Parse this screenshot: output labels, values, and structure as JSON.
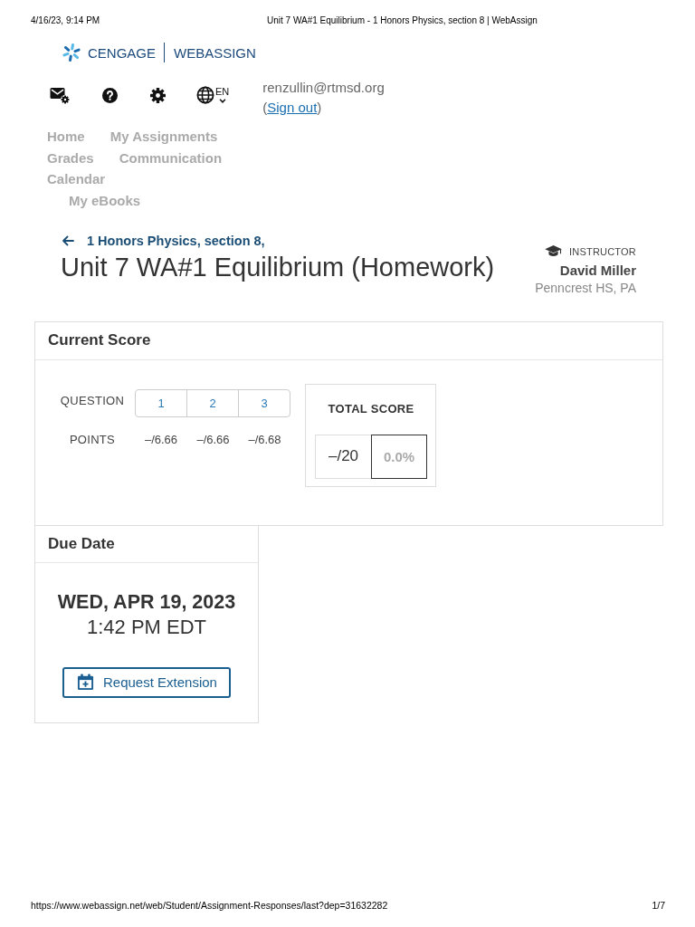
{
  "print_header": {
    "date": "4/16/23, 9:14 PM",
    "title": "Unit 7 WA#1 Equilibrium - 1 Honors Physics, section 8 | WebAssign"
  },
  "logo": {
    "brand": "CENGAGE",
    "product": "WEBASSIGN"
  },
  "toolbar": {
    "language": "EN"
  },
  "account": {
    "email": "renzullin@rtmsd.org",
    "sign_out": {
      "open": "(",
      "link": "Sign out",
      "close": ")"
    }
  },
  "nav_rows": [
    {
      "items": [
        {
          "label": "Home"
        },
        {
          "label": "My Assignments"
        }
      ]
    },
    {
      "items": [
        {
          "label": "Grades"
        },
        {
          "label": "Communication"
        }
      ]
    },
    {
      "items": [
        {
          "label": "Calendar"
        }
      ]
    },
    {
      "items": [
        {
          "label": "My eBooks"
        }
      ]
    }
  ],
  "course": {
    "back_link": "1 Honors Physics, section 8,",
    "title": "Unit 7 WA#1 Equilibrium (Homework)"
  },
  "instructor": {
    "label": "INSTRUCTOR",
    "name": "David Miller",
    "school": "Penncrest HS, PA"
  },
  "current_score": {
    "title": "Current Score",
    "question_label": "QUESTION",
    "points_label": "POINTS",
    "questions": [
      {
        "number": "1",
        "points": "–/6.66"
      },
      {
        "number": "2",
        "points": "–/6.66"
      },
      {
        "number": "3",
        "points": "–/6.68"
      }
    ],
    "total": {
      "label": "TOTAL SCORE",
      "points": "–/20",
      "percent": "0.0%"
    }
  },
  "due_date": {
    "title": "Due Date",
    "date": "WED, APR 19, 2023",
    "time": "1:42 PM EDT",
    "button": "Request Extension"
  },
  "print_footer": {
    "url": "https://www.webassign.net/web/Student/Assignment-Responses/last?dep=31632282",
    "page": "1/7"
  }
}
